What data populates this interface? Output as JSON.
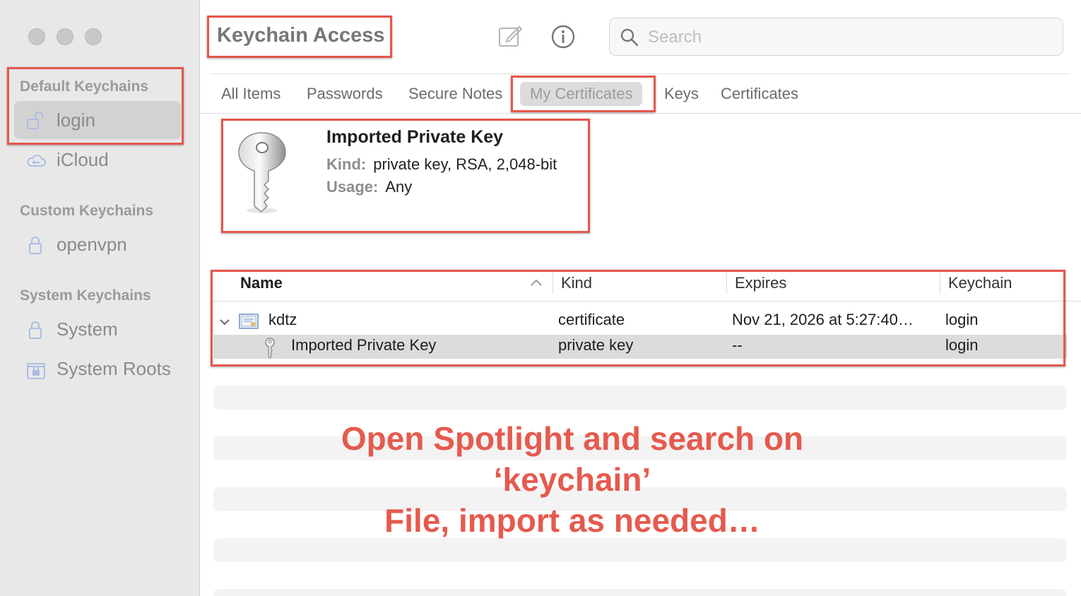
{
  "app": {
    "title": "Keychain Access"
  },
  "search": {
    "placeholder": "Search"
  },
  "sidebar": {
    "sections": [
      {
        "header": "Default Keychains",
        "items": [
          {
            "label": "login",
            "icon": "unlocked-padlock-icon",
            "selected": true
          },
          {
            "label": "iCloud",
            "icon": "cloud-icon"
          }
        ]
      },
      {
        "header": "Custom Keychains",
        "items": [
          {
            "label": "openvpn",
            "icon": "padlock-icon"
          }
        ]
      },
      {
        "header": "System Keychains",
        "items": [
          {
            "label": "System",
            "icon": "padlock-icon"
          },
          {
            "label": "System Roots",
            "icon": "locked-cabinet-icon"
          }
        ]
      }
    ]
  },
  "tabs": [
    {
      "label": "All Items"
    },
    {
      "label": "Passwords"
    },
    {
      "label": "Secure Notes"
    },
    {
      "label": "My Certificates",
      "active": true
    },
    {
      "label": "Keys"
    },
    {
      "label": "Certificates"
    }
  ],
  "detail": {
    "title": "Imported Private Key",
    "kind_label": "Kind:",
    "kind_value": "private key, RSA, 2,048-bit",
    "usage_label": "Usage:",
    "usage_value": "Any"
  },
  "table": {
    "columns": [
      "Name",
      "Kind",
      "Expires",
      "Keychain"
    ],
    "rows": [
      {
        "name": "kdtz",
        "kind": "certificate",
        "expires": "Nov 21, 2026 at 5:27:40…",
        "keychain": "login"
      },
      {
        "name": "Imported Private Key",
        "kind": "private key",
        "expires": "--",
        "keychain": "login"
      }
    ]
  },
  "annotation": {
    "lines": [
      "Open Spotlight and search on",
      "‘keychain’",
      "File, import as needed…"
    ],
    "color": "#e55a4e"
  },
  "colors": {
    "annotation_box": "#e4574b",
    "sidebar_bg": "#e9e8e9"
  }
}
